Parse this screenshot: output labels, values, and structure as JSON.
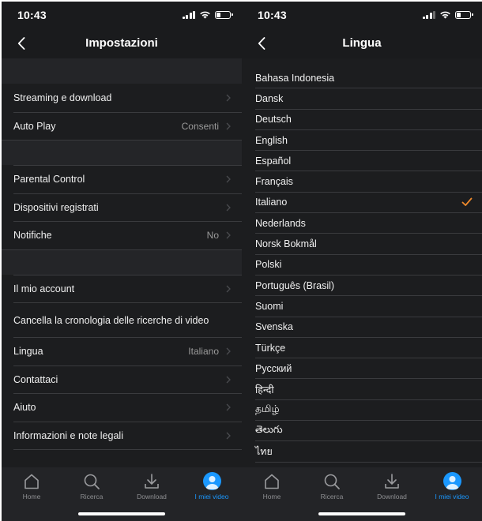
{
  "status_bar": {
    "time": "10:43"
  },
  "settings_screen": {
    "title": "Impostazioni",
    "sections": [
      [
        {
          "label": "Streaming e download",
          "value": ""
        },
        {
          "label": "Auto Play",
          "value": "Consenti"
        }
      ],
      [
        {
          "label": "Parental Control",
          "value": ""
        },
        {
          "label": "Dispositivi registrati",
          "value": ""
        },
        {
          "label": "Notifiche",
          "value": "No"
        }
      ],
      [
        {
          "label": "Il mio account",
          "value": ""
        },
        {
          "label": "Cancella la cronologia delle ricerche di video",
          "value": ""
        },
        {
          "label": "Lingua",
          "value": "Italiano"
        },
        {
          "label": "Contattaci",
          "value": ""
        },
        {
          "label": "Aiuto",
          "value": ""
        },
        {
          "label": "Informazioni e note legali",
          "value": ""
        }
      ]
    ]
  },
  "language_screen": {
    "title": "Lingua",
    "selected": "Italiano",
    "languages": [
      "Bahasa Indonesia",
      "Dansk",
      "Deutsch",
      "English",
      "Español",
      "Français",
      "Italiano",
      "Nederlands",
      "Norsk Bokmål",
      "Polski",
      "Português (Brasil)",
      "Suomi",
      "Svenska",
      "Türkçe",
      "Русский",
      "हिन्दी",
      "தமிழ்",
      "తెలుగు",
      "ไทย"
    ]
  },
  "tab_bar": {
    "tabs": [
      {
        "label": "Home",
        "icon": "home-icon"
      },
      {
        "label": "Ricerca",
        "icon": "search-icon"
      },
      {
        "label": "Download",
        "icon": "download-icon"
      },
      {
        "label": "I miei video",
        "icon": "avatar-icon"
      }
    ],
    "active_index": 3
  },
  "colors": {
    "accent": "#1a98ff",
    "checkmark": "#f08a2c",
    "background": "#1c1d1f"
  }
}
